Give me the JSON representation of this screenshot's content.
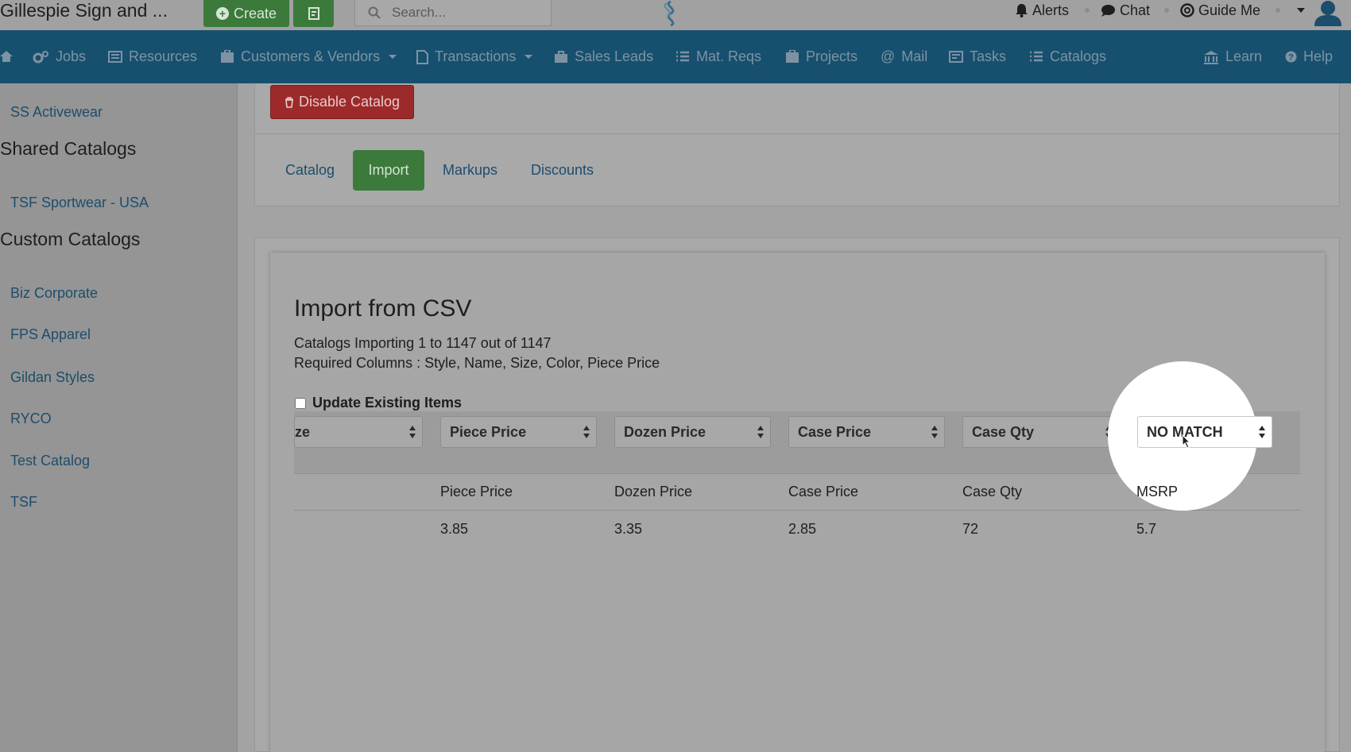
{
  "topbar": {
    "company": "Gillespie Sign and ...",
    "create_label": "Create",
    "search_placeholder": "Search...",
    "alerts": "Alerts",
    "chat": "Chat",
    "guide_me": "Guide Me"
  },
  "nav": {
    "items": [
      "Jobs",
      "Resources",
      "Customers & Vendors",
      "Transactions",
      "Sales Leads",
      "Mat. Reqs",
      "Projects",
      "Mail",
      "Tasks",
      "Catalogs"
    ],
    "learn": "Learn",
    "help": "Help"
  },
  "sidebar": {
    "top_link": "SS Activewear",
    "shared_heading": "Shared Catalogs",
    "shared_items": [
      "TSF Sportwear - USA"
    ],
    "custom_heading": "Custom Catalogs",
    "custom_items": [
      "Biz Corporate",
      "FPS Apparel",
      "Gildan Styles",
      "RYCO",
      "Test Catalog",
      "TSF"
    ]
  },
  "catalog": {
    "disable_label": "Disable Catalog",
    "tabs": [
      "Catalog",
      "Import",
      "Markups",
      "Discounts"
    ],
    "active_tab": "Import"
  },
  "import": {
    "title": "Import from CSV",
    "status_line": "Catalogs Importing 1 to 1147 out of 1147",
    "required_line": "Required Columns : Style, Name, Size, Color, Piece Price",
    "update_label": "Update Existing Items",
    "selects": [
      "ze",
      "Piece Price",
      "Dozen Price",
      "Case Price",
      "Case Qty",
      "NO MATCH"
    ],
    "headers": [
      "Piece Price",
      "Dozen Price",
      "Case Price",
      "Case Qty",
      "MSRP"
    ],
    "row": [
      "3.85",
      "3.35",
      "2.85",
      "72",
      "5.7"
    ]
  },
  "colors": {
    "nav_bg": "#17506f",
    "green": "#3c7a3c",
    "red": "#9c2a2a",
    "link": "#1d4d6c"
  }
}
